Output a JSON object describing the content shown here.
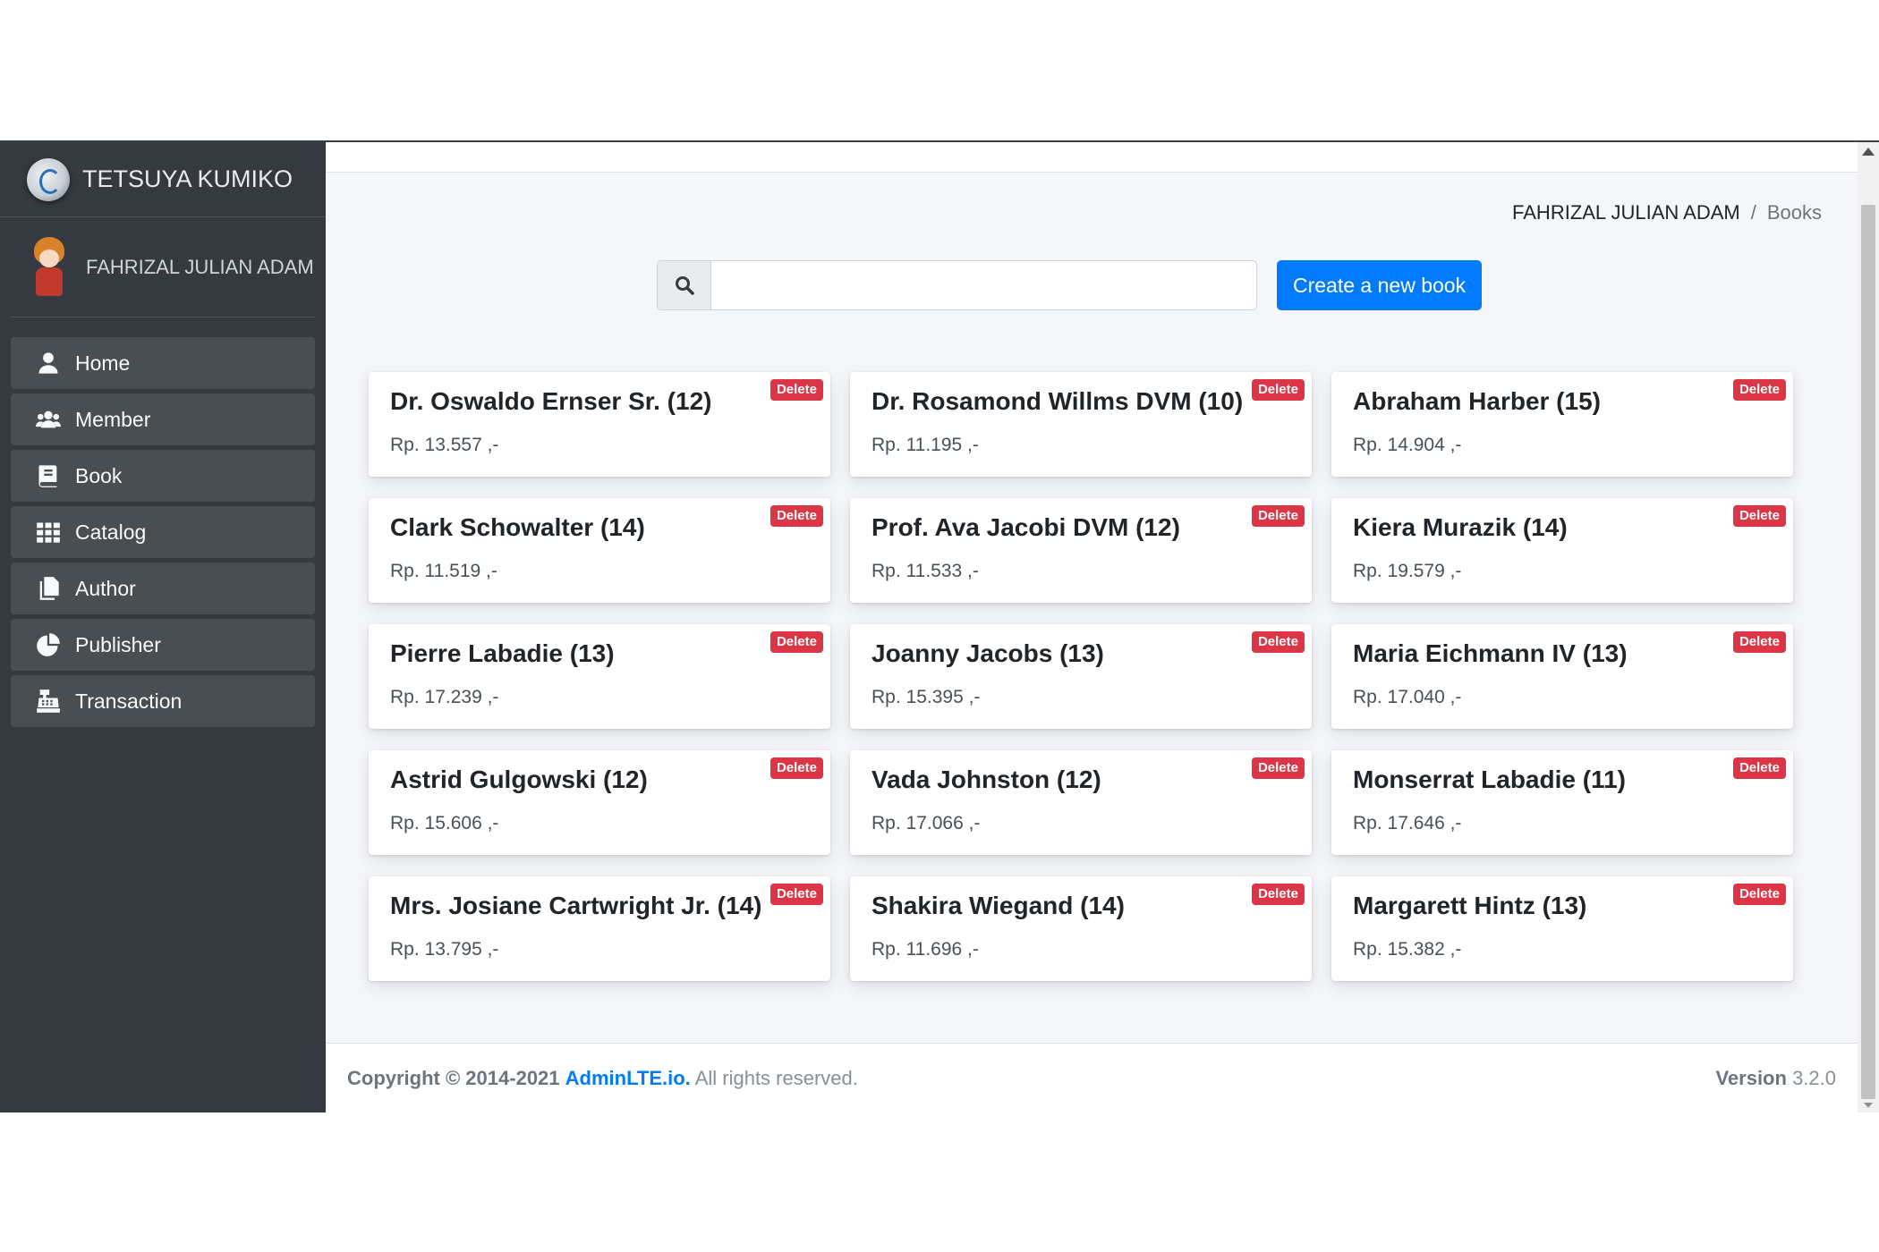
{
  "brand": {
    "name": "TETSUYA KUMIKO"
  },
  "user": {
    "name": "FAHRIZAL JULIAN ADAM"
  },
  "nav": [
    {
      "label": "Home",
      "icon": "user-icon"
    },
    {
      "label": "Member",
      "icon": "users-icon"
    },
    {
      "label": "Book",
      "icon": "book-icon"
    },
    {
      "label": "Catalog",
      "icon": "grid-icon"
    },
    {
      "label": "Author",
      "icon": "copy-icon"
    },
    {
      "label": "Publisher",
      "icon": "pie-chart-icon"
    },
    {
      "label": "Transaction",
      "icon": "cash-register-icon"
    }
  ],
  "breadcrumb": {
    "home": "FAHRIZAL JULIAN ADAM",
    "current": "Books"
  },
  "search": {
    "value": "",
    "placeholder": ""
  },
  "create_button": "Create a new book",
  "delete_label": "Delete",
  "books": [
    {
      "title": "Dr. Oswaldo Ernser Sr. (12)",
      "price": "Rp. 13.557 ,-"
    },
    {
      "title": "Dr. Rosamond Willms DVM (10)",
      "price": "Rp. 11.195 ,-"
    },
    {
      "title": "Abraham Harber (15)",
      "price": "Rp. 14.904 ,-"
    },
    {
      "title": "Clark Schowalter (14)",
      "price": "Rp. 11.519 ,-"
    },
    {
      "title": "Prof. Ava Jacobi DVM (12)",
      "price": "Rp. 11.533 ,-"
    },
    {
      "title": "Kiera Murazik (14)",
      "price": "Rp. 19.579 ,-"
    },
    {
      "title": "Pierre Labadie (13)",
      "price": "Rp. 17.239 ,-"
    },
    {
      "title": "Joanny Jacobs (13)",
      "price": "Rp. 15.395 ,-"
    },
    {
      "title": "Maria Eichmann IV (13)",
      "price": "Rp. 17.040 ,-"
    },
    {
      "title": "Astrid Gulgowski (12)",
      "price": "Rp. 15.606 ,-"
    },
    {
      "title": "Vada Johnston (12)",
      "price": "Rp. 17.066 ,-"
    },
    {
      "title": "Monserrat Labadie (11)",
      "price": "Rp. 17.646 ,-"
    },
    {
      "title": "Mrs. Josiane Cartwright Jr. (14)",
      "price": "Rp. 13.795 ,-"
    },
    {
      "title": "Shakira Wiegand (14)",
      "price": "Rp. 11.696 ,-"
    },
    {
      "title": "Margarett Hintz (13)",
      "price": "Rp. 15.382 ,-"
    }
  ],
  "footer": {
    "copyright": "Copyright © 2014-2021",
    "link": "AdminLTE.io.",
    "rights": "All rights reserved.",
    "version_label": "Version",
    "version": "3.2.0"
  },
  "colors": {
    "sidebar": "#343a40",
    "primary": "#007bff",
    "danger": "#dc3545",
    "content_bg": "#f4f6f9"
  }
}
